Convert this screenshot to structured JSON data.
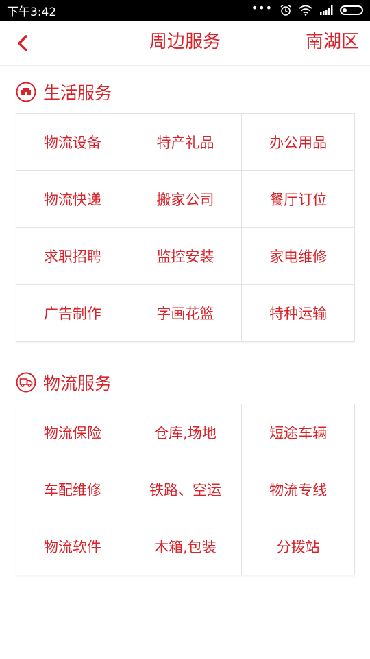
{
  "status_bar": {
    "time": "下午3:42",
    "icons": [
      "more-dots-icon",
      "alarm-icon",
      "wifi-icon",
      "signal-icon",
      "battery-icon"
    ]
  },
  "header": {
    "back_icon": "chevron-left-icon",
    "title": "周边服务",
    "region": "南湖区"
  },
  "sections": [
    {
      "title": "生活服务",
      "icon": "store-icon",
      "items": [
        "物流设备",
        "特产礼品",
        "办公用品",
        "物流快递",
        "搬家公司",
        "餐厅订位",
        "求职招聘",
        "监控安装",
        "家电维修",
        "广告制作",
        "字画花篮",
        "特种运输"
      ]
    },
    {
      "title": "物流服务",
      "icon": "truck-icon",
      "items": [
        "物流保险",
        "仓库,场地",
        "短途车辆",
        "车配维修",
        "铁路、空运",
        "物流专线",
        "物流软件",
        "木箱,包装",
        "分拨站"
      ]
    }
  ],
  "colors": {
    "accent": "#d9232a",
    "divider": "#e3e3e3",
    "status_bar_bg": "#000000"
  }
}
